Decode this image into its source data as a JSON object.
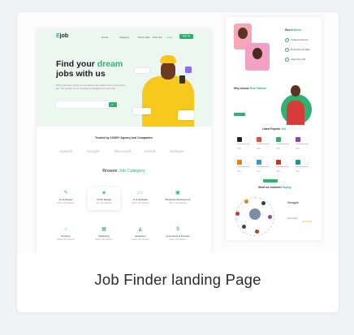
{
  "caption": "Job Finder landing Page",
  "colors": {
    "accent": "#2fb171",
    "hero_bg": "#edf7f2",
    "person": "#f7c91c"
  },
  "landing": {
    "logo": {
      "prefix": "E",
      "suffix": "job"
    },
    "nav": [
      "Home",
      "Category",
      "Show Jobs",
      "Post Job"
    ],
    "login": "Login",
    "signup": "Sign Up",
    "hero": {
      "title_1": "Find your ",
      "title_green": "dream",
      "title_2": "jobs  with us",
      "subtitle": "With a few lines of text you can always see what's new in your dream job. The number of the company is available here and now."
    },
    "trusted_title": "Trusted by 10000+ Agency and Companies",
    "brands": [
      "Upwork",
      "Google",
      "Microsoft",
      "Airbnb",
      "Walmart"
    ],
    "browse": {
      "prefix": "Browse ",
      "green": "Job  Category"
    },
    "categories": [
      {
        "name": "Art & Design",
        "count": "2000+ Job Vacancy",
        "icon": "pen-icon"
      },
      {
        "name": "UI/UX  Design",
        "count": "3K+ Job Vacancy",
        "icon": "layers-icon"
      },
      {
        "name": "IT & Software",
        "count": "1500+ Job Vacancy",
        "icon": "monitor-icon"
      },
      {
        "name": "Business Development",
        "count": "1500+ Job Vacancy",
        "icon": "briefcase-icon"
      },
      {
        "name": "Property",
        "count": "2000+ Job Vacancy",
        "icon": "home-icon"
      },
      {
        "name": "Marketing",
        "count": "3500+ Job Vacancy",
        "icon": "chart-icon"
      },
      {
        "name": "Education",
        "count": "1200+ Job Vacancy",
        "icon": "cap-icon"
      },
      {
        "name": "Accounting & Finance",
        "count": "1800+ Job Vacancy",
        "icon": "dollar-icon"
      }
    ]
  },
  "secondary": {
    "how": {
      "prefix": "How it ",
      "green": "Works"
    },
    "steps": [
      "Create An Account",
      "Find A Job You Want",
      "Apply For A Job"
    ],
    "why": {
      "prefix": "Why choose ",
      "green": "Best Platform"
    },
    "latest": {
      "prefix": "Latest Popular ",
      "green": "Job"
    },
    "review": {
      "prefix": "What our customer ",
      "green": "Saying"
    },
    "review_brand": "Google",
    "reviewer": "John Smith",
    "stars": "★★★★★"
  }
}
